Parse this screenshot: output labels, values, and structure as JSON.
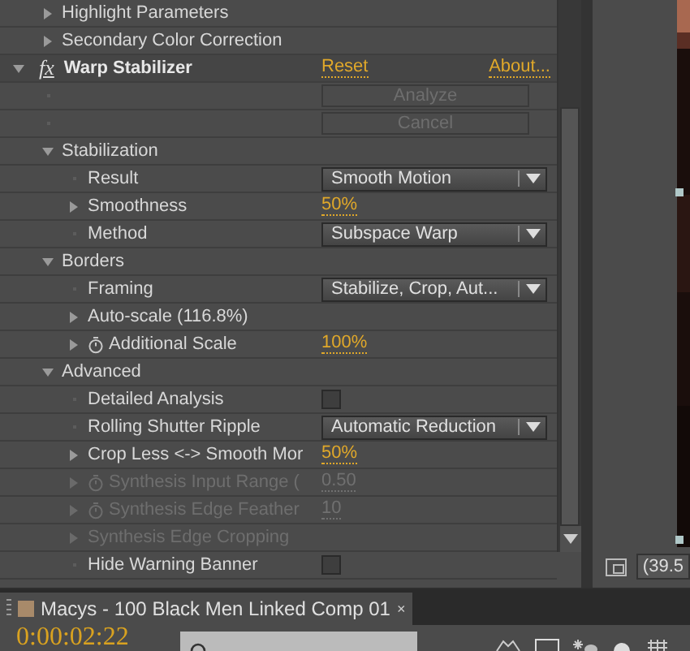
{
  "effects": [
    {
      "children": [
        {
          "label": "Highlight Parameters",
          "expanded": false
        },
        {
          "label": "Secondary Color Correction",
          "expanded": false
        }
      ]
    },
    {
      "badge": "fx",
      "name": "Warp Stabilizer",
      "expanded": true,
      "links": [
        "Reset",
        "About..."
      ],
      "children": [
        {
          "kind": "button",
          "button": "Analyze",
          "disabled": true
        },
        {
          "kind": "button",
          "button": "Cancel",
          "disabled": true
        },
        {
          "label": "Stabilization",
          "expanded": true,
          "children": [
            {
              "label": "Result",
              "kind": "dropdown",
              "value": "Smooth Motion"
            },
            {
              "label": "Smoothness",
              "expanded": false,
              "kind": "number",
              "value": "50%"
            },
            {
              "label": "Method",
              "kind": "dropdown",
              "value": "Subspace Warp"
            }
          ]
        },
        {
          "label": "Borders",
          "expanded": true,
          "children": [
            {
              "label": "Framing",
              "kind": "dropdown",
              "value": "Stabilize, Crop, Aut..."
            },
            {
              "label": "Auto-scale (116.8%)",
              "expanded": false
            },
            {
              "label": "Additional Scale",
              "expanded": false,
              "stopwatch": true,
              "kind": "number",
              "value": "100%"
            }
          ]
        },
        {
          "label": "Advanced",
          "expanded": true,
          "children": [
            {
              "label": "Detailed Analysis",
              "kind": "checkbox",
              "checked": false
            },
            {
              "label": "Rolling Shutter Ripple",
              "kind": "dropdown",
              "value": "Automatic Reduction"
            },
            {
              "label": "Crop Less <-> Smooth Mor",
              "expanded": false,
              "kind": "number",
              "value": "50%"
            },
            {
              "label": "Synthesis Input Range (",
              "expanded": false,
              "stopwatch": true,
              "disabled": true,
              "kind": "number",
              "value": "0.50"
            },
            {
              "label": "Synthesis Edge Feather",
              "expanded": false,
              "stopwatch": true,
              "disabled": true,
              "kind": "number",
              "value": "10"
            },
            {
              "label": "Synthesis Edge Cropping",
              "expanded": false,
              "disabled": true
            },
            {
              "label": "Hide Warning Banner",
              "kind": "checkbox",
              "checked": false
            }
          ]
        }
      ]
    }
  ],
  "viewer": {
    "zoom": "(39.5"
  },
  "composition": {
    "tab": "Macys - 100 Black Men Linked Comp 01",
    "close": "×",
    "timecode": "0:00:02:22"
  }
}
